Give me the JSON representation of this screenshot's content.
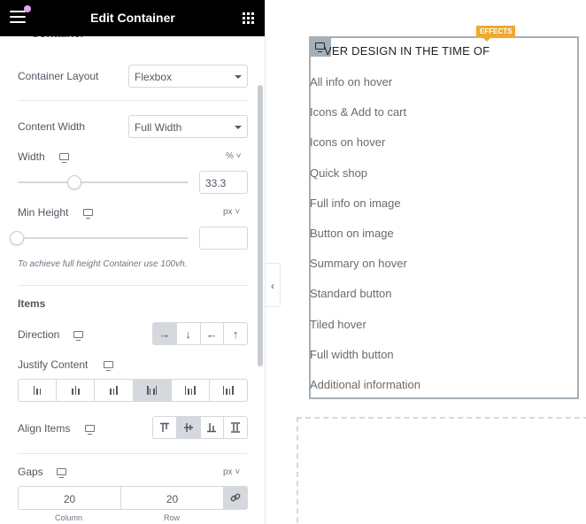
{
  "header": {
    "title": "Edit Container"
  },
  "section_cut_title": "Container",
  "container_layout": {
    "label": "Container Layout",
    "value": "Flexbox"
  },
  "content_width": {
    "label": "Content Width",
    "value": "Full Width"
  },
  "width": {
    "label": "Width",
    "unit": "%",
    "value": "33.3",
    "slider_fraction": 0.333
  },
  "min_height": {
    "label": "Min Height",
    "unit": "px",
    "value": "",
    "slider_fraction": 0.0,
    "hint": "To achieve full height Container use 100vh."
  },
  "items": {
    "heading": "Items",
    "direction": {
      "label": "Direction",
      "options": [
        "→",
        "↓",
        "←",
        "↑"
      ],
      "active_index": 0
    },
    "justify_content": {
      "label": "Justify Content",
      "active_index": 3
    },
    "align_items": {
      "label": "Align Items",
      "active_index": 1
    }
  },
  "gaps": {
    "label": "Gaps",
    "unit": "px",
    "column_value": "20",
    "row_value": "20",
    "column_caption": "Column",
    "row_caption": "Row"
  },
  "canvas": {
    "badge": "EFFECTS",
    "heading": "VER DESIGN IN THE TIME OF",
    "items": [
      "All info on hover",
      "Icons & Add to cart",
      "Icons on hover",
      "Quick shop",
      "Full info on image",
      "Button on image",
      "Summary on hover",
      "Standard button",
      "Tiled hover",
      "Full width button",
      "Additional information"
    ]
  },
  "colors": {
    "header_bg": "#000000",
    "badge": "#f0a830",
    "container_border": "#a4afb7",
    "accent_dot": "#e5a2f2"
  }
}
